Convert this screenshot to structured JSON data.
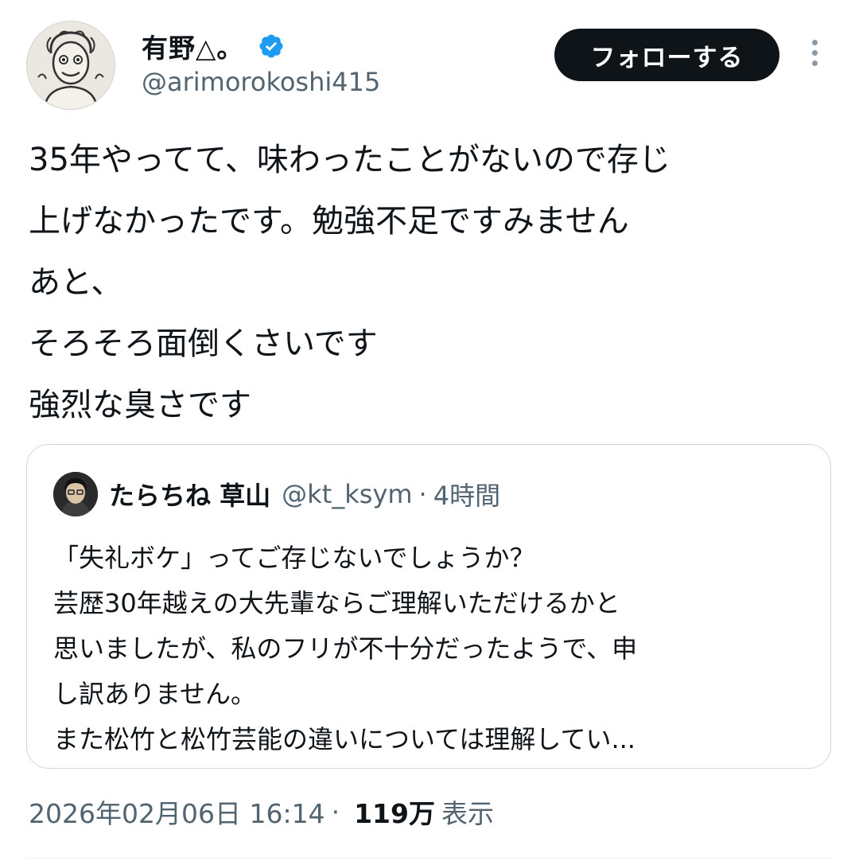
{
  "author": {
    "display_name": "有野△。",
    "handle": "@arimorokoshi415",
    "verified": true,
    "avatar_icon": "avatar-drawing-icon"
  },
  "actions": {
    "follow_label": "フォローする",
    "more_icon": "more-vertical-icon"
  },
  "tweet": {
    "lines": [
      "35年やってて、味わったことがないので存じ",
      "上げなかったです。勉強不足ですみません",
      "あと、",
      "そろそろ面倒くさいです",
      "強烈な臭さです"
    ]
  },
  "quote": {
    "display_name": "たらちね 草山",
    "handle": "@kt_ksym",
    "dot": "·",
    "time": "4時間",
    "lines": [
      "「失礼ボケ」ってご存じないでしょうか？",
      "芸歴30年越えの大先輩ならご理解いただけるかと",
      "思いましたが、私のフリが不十分だったようで、申",
      "し訳ありません。",
      "また松竹と松竹芸能の違いについては理解してい..."
    ]
  },
  "meta": {
    "datetime": "2026年02月06日 16:14",
    "sep": "·",
    "views": "119万",
    "views_label": "表示"
  },
  "colors": {
    "text": "#0f1419",
    "secondary": "#536471",
    "verified": "#1d9bf0",
    "border": "#cfd9de"
  }
}
